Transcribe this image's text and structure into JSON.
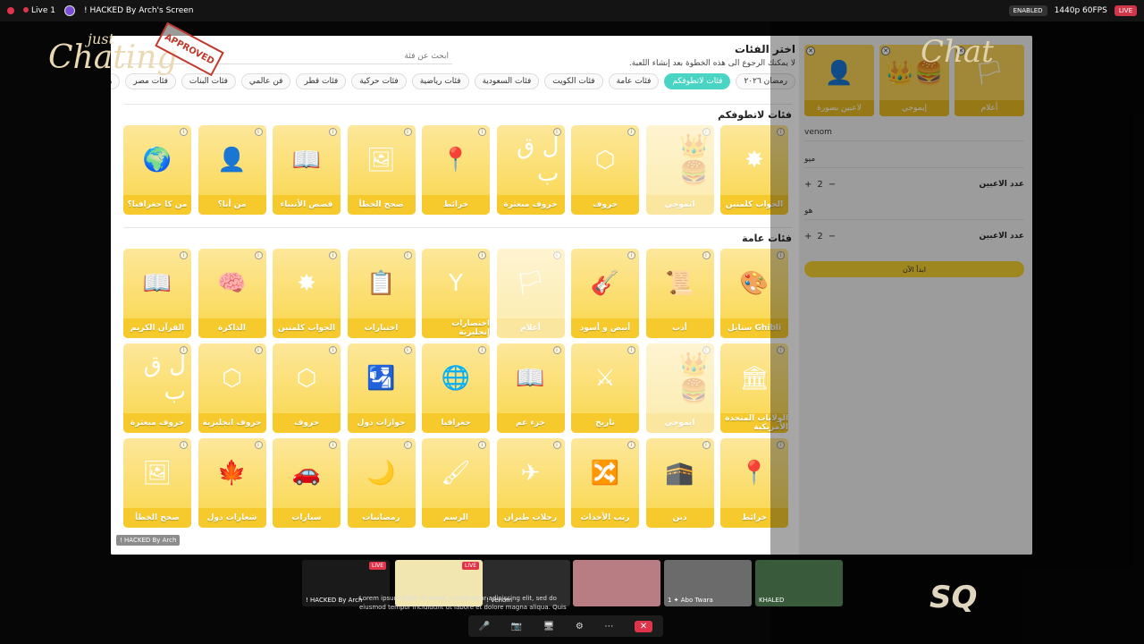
{
  "topbar": {
    "live_label": "Live 1",
    "screen_title": "! HACKED By Arch's Screen",
    "enabled_label": "ENABLED",
    "quality_label": "1440p 60FPS",
    "live_badge": "LIVE"
  },
  "overlay": {
    "just": "just",
    "chatting": "Chating",
    "stamp": "APPROVED",
    "chat": "Chat"
  },
  "app": {
    "search_placeholder": "ابحث عن فئة",
    "title": "اختر الفئات",
    "subtitle": "لا يمكنك الرجوع الى هذه الخطوة بعد إنشاء اللعبة.",
    "tabs": [
      {
        "label": "رمضان ٢٠٢٦",
        "active": false
      },
      {
        "label": "فئات لاتطوفكم",
        "active": true
      },
      {
        "label": "فئات عامة",
        "active": false
      },
      {
        "label": "فئات الكويت",
        "active": false
      },
      {
        "label": "فئات السعودية",
        "active": false
      },
      {
        "label": "فئات رياضية",
        "active": false
      },
      {
        "label": "فئات حركية",
        "active": false
      },
      {
        "label": "فئات قطر",
        "active": false
      },
      {
        "label": "فن عالمي",
        "active": false
      },
      {
        "label": "فئات البنات",
        "active": false
      },
      {
        "label": "فئات مصر",
        "active": false
      },
      {
        "label": "رسوم متحركة",
        "active": false
      }
    ],
    "section1_title": "فئات لاتطوفكم",
    "section1_cards": [
      {
        "label": "الجواب كلمتين",
        "icon": "✸",
        "faded": false
      },
      {
        "label": "ايموجي",
        "icon": "👑🍔",
        "faded": true
      },
      {
        "label": "حروف",
        "icon": "⬡",
        "faded": false
      },
      {
        "label": "حروف مبعثرة",
        "icon": "ل ق ب",
        "faded": false
      },
      {
        "label": "خرائط",
        "icon": "📍",
        "faded": false
      },
      {
        "label": "صحح الخطأ",
        "icon": "🖼",
        "faded": false
      },
      {
        "label": "قصص الأنبياء",
        "icon": "📖",
        "faded": false
      },
      {
        "label": "من أنا؟",
        "icon": "👤",
        "faded": false
      },
      {
        "label": "من كا جغرافيا؟",
        "icon": "🌍",
        "faded": false
      }
    ],
    "section2_title": "فئات عامة",
    "section2_cards": [
      {
        "label": "Ghibli ستايل",
        "icon": "🎨",
        "faded": false
      },
      {
        "label": "أدب",
        "icon": "📜",
        "faded": false
      },
      {
        "label": "أبيض و أسود",
        "icon": "🎸",
        "faded": false
      },
      {
        "label": "أعلام",
        "icon": "🏳",
        "faded": true
      },
      {
        "label": "اختصارات إنجليزية",
        "icon": "Y",
        "faded": false
      },
      {
        "label": "اختبارات",
        "icon": "📋",
        "faded": false
      },
      {
        "label": "الجواب كلمتين",
        "icon": "✸",
        "faded": false
      },
      {
        "label": "الذاكرة",
        "icon": "🧠",
        "faded": false
      },
      {
        "label": "القرآن الكريم",
        "icon": "📖",
        "faded": false
      },
      {
        "label": "الولايات المتحدة الأمريكية",
        "icon": "🏛",
        "faded": false
      },
      {
        "label": "ايموجي",
        "icon": "👑🍔",
        "faded": true
      },
      {
        "label": "تاريخ",
        "icon": "⚔",
        "faded": false
      },
      {
        "label": "جزء عم",
        "icon": "📖",
        "faded": false
      },
      {
        "label": "جغرافيا",
        "icon": "🌐",
        "faded": false
      },
      {
        "label": "جوازات دول",
        "icon": "🛂",
        "faded": false
      },
      {
        "label": "حروف",
        "icon": "⬡",
        "faded": false
      },
      {
        "label": "حروف انجليزية",
        "icon": "⬡",
        "faded": false
      },
      {
        "label": "حروف مبعثرة",
        "icon": "ل ق ب",
        "faded": false
      },
      {
        "label": "خرائط",
        "icon": "📍",
        "faded": false
      },
      {
        "label": "دين",
        "icon": "🕋",
        "faded": false
      },
      {
        "label": "رتب الأحداث",
        "icon": "🔀",
        "faded": false
      },
      {
        "label": "رحلات طيران",
        "icon": "✈",
        "faded": false
      },
      {
        "label": "الرسم",
        "icon": "🖌",
        "faded": false
      },
      {
        "label": "رمضانيات",
        "icon": "🌙",
        "faded": false
      },
      {
        "label": "سيارات",
        "icon": "🚗",
        "faded": false
      },
      {
        "label": "شعارات دول",
        "icon": "🍁",
        "faded": false
      },
      {
        "label": "صحح الخطأ",
        "icon": "🖼",
        "faded": false
      }
    ]
  },
  "right_panel": {
    "team_cards": [
      {
        "label": "لاعبين بصورة",
        "icon": "👤"
      },
      {
        "label": "إيموجي",
        "icon": "👑🍔"
      },
      {
        "label": "أعلام",
        "icon": "🏳"
      }
    ],
    "team1_name": "venom",
    "team2_name": "ميو",
    "players_label_1": "عدد الاعبين",
    "players_count_1": "2",
    "team3_name": "هو",
    "players_label_2": "عدد الاعبين",
    "players_count_2": "2",
    "start_button": "ابدأ الآن"
  },
  "bottom": {
    "tiles": [
      {
        "name": "! HACKED By Arch",
        "live": "LIVE"
      },
      {
        "name": "",
        "live": "LIVE"
      },
      {
        "name": "! Venom",
        "live": ""
      },
      {
        "name": "",
        "live": ""
      },
      {
        "name": "1 ✦ Abo Twara",
        "live": ""
      },
      {
        "name": "KHALED",
        "live": ""
      }
    ],
    "marquee": "Lorem ipsum dolor sit amet, consectetur adipiscing elit, sed do eiusmod tempor incididunt ut labore et dolore magna aliqua. Quis",
    "notification": "! HACKED By Arch",
    "logo": "SQ"
  }
}
